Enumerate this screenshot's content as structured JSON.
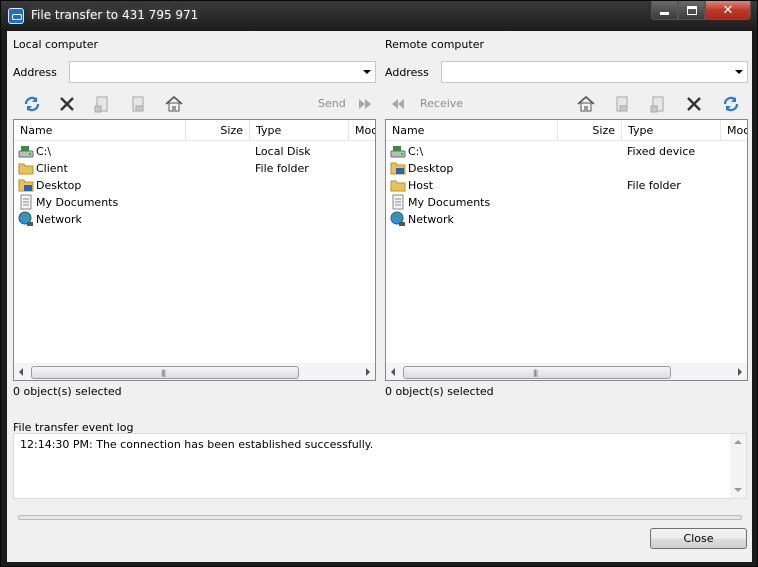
{
  "window": {
    "title": "File transfer to 431 795 971"
  },
  "local": {
    "section_label": "Local computer",
    "address_label": "Address",
    "address_value": "",
    "send_label": "Send",
    "columns": [
      "Name",
      "Size",
      "Type",
      "Moc"
    ],
    "items": [
      {
        "name": "C:\\",
        "type": "Local Disk",
        "icon": "drive-icon"
      },
      {
        "name": "Client",
        "type": "File folder",
        "icon": "folder-icon"
      },
      {
        "name": "Desktop",
        "type": "",
        "icon": "desktop-folder-icon"
      },
      {
        "name": "My Documents",
        "type": "",
        "icon": "documents-icon"
      },
      {
        "name": "Network",
        "type": "",
        "icon": "network-icon"
      }
    ],
    "status": "0 object(s) selected"
  },
  "remote": {
    "section_label": "Remote computer",
    "address_label": "Address",
    "address_value": "",
    "receive_label": "Receive",
    "columns": [
      "Name",
      "Size",
      "Type",
      "Moc"
    ],
    "items": [
      {
        "name": "C:\\",
        "type": "Fixed device",
        "icon": "drive-icon"
      },
      {
        "name": "Desktop",
        "type": "",
        "icon": "desktop-folder-icon"
      },
      {
        "name": "Host",
        "type": "File folder",
        "icon": "folder-icon"
      },
      {
        "name": "My Documents",
        "type": "",
        "icon": "documents-icon"
      },
      {
        "name": "Network",
        "type": "",
        "icon": "network-icon"
      }
    ],
    "status": "0 object(s) selected"
  },
  "log": {
    "label": "File transfer event log",
    "entries": [
      "12:14:30 PM: The connection has been established successfully."
    ]
  },
  "progress": {
    "fraction": 0
  },
  "buttons": {
    "close_label": "Close"
  },
  "colors": {
    "accent": "#1f6fc7",
    "close_red": "#c1392b",
    "folder": "#e8c35a"
  }
}
